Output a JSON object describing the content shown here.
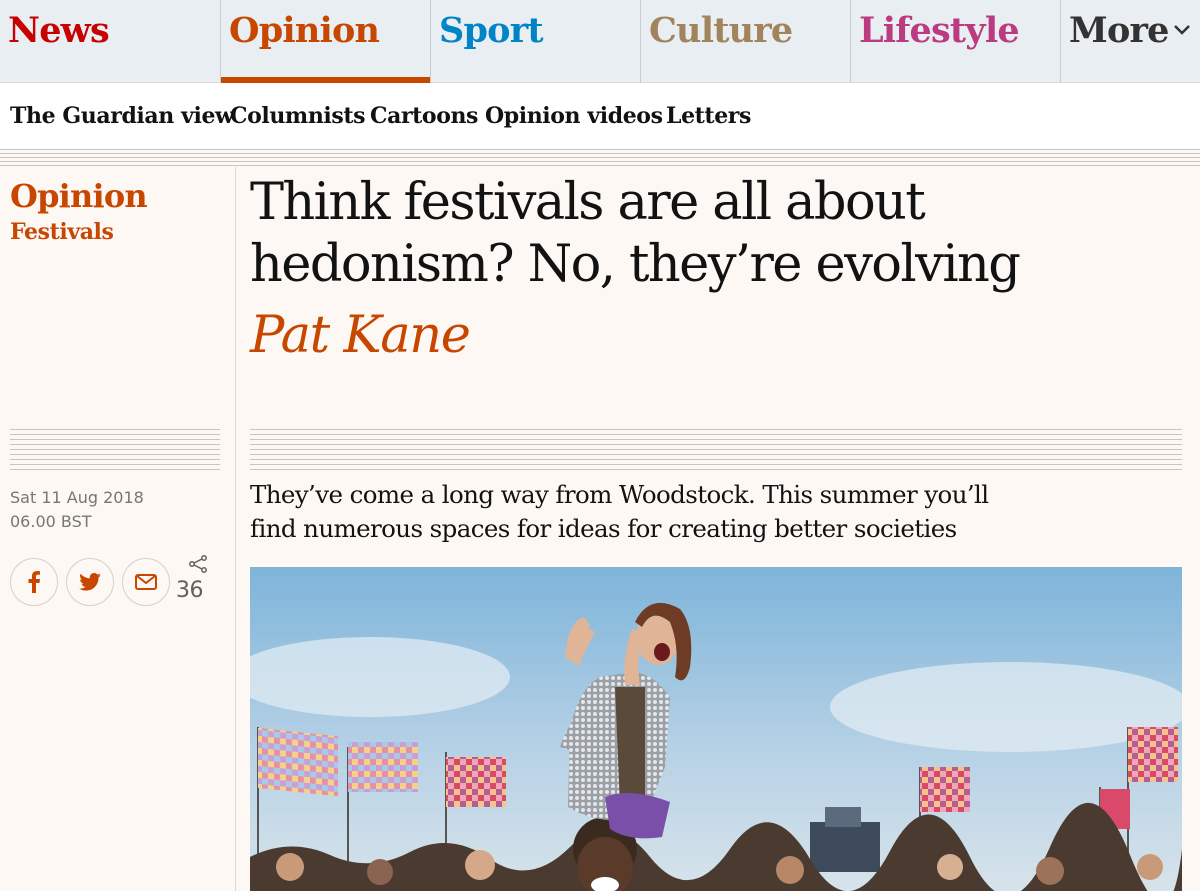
{
  "nav": {
    "pillars": [
      {
        "label": "News",
        "color": "#c70000"
      },
      {
        "label": "Opinion",
        "color": "#c74600",
        "active": true
      },
      {
        "label": "Sport",
        "color": "#0084c6"
      },
      {
        "label": "Culture",
        "color": "#a1845c"
      },
      {
        "label": "Lifestyle",
        "color": "#bb3b80"
      },
      {
        "label": "More",
        "color": "#333333"
      }
    ],
    "subnav": [
      "The Guardian view",
      "Columnists",
      "Cartoons",
      "Opinion videos",
      "Letters"
    ]
  },
  "article": {
    "section": "Opinion",
    "series": "Festivals",
    "headline_line1": "Think festivals are all about",
    "headline_line2": "hedonism? No, they’re evolving",
    "byline": "Pat Kane",
    "date": "Sat 11 Aug 2018",
    "time": "06.00 BST",
    "standfirst_line1": "They’ve come a long way from Woodstock. This summer you’ll",
    "standfirst_line2": "find numerous spaces for ideas for creating better societies",
    "share_count": "36",
    "share_icons": [
      "facebook-icon",
      "twitter-icon",
      "email-icon",
      "share-icon"
    ]
  },
  "colors": {
    "opinion_accent": "#c74600",
    "background": "#fdf8f3",
    "nav_background": "#e9eef2"
  }
}
